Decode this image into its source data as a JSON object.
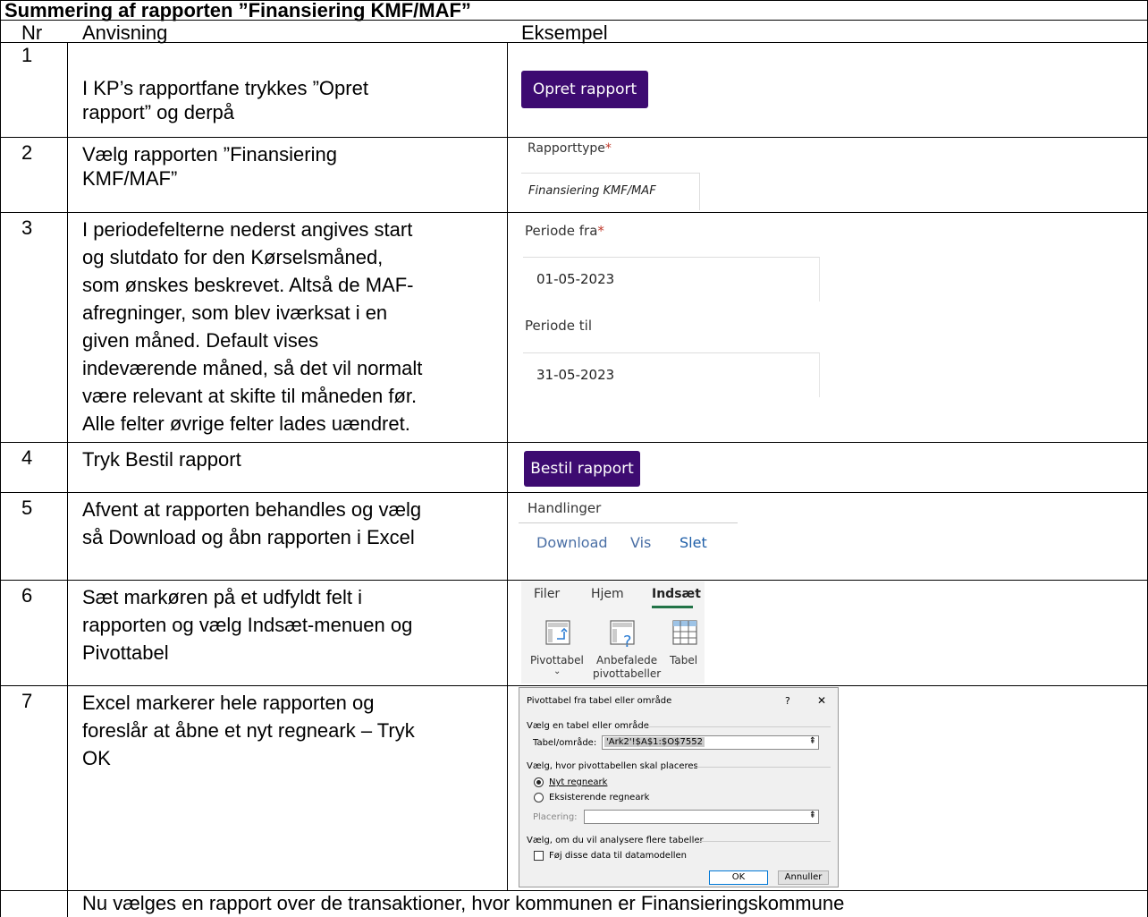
{
  "title": "Summering af rapporten ”Finansiering KMF/MAF”",
  "columns": {
    "nr": "Nr",
    "instruction": "Anvisning",
    "example": "Eksempel"
  },
  "rows": [
    {
      "nr": "1",
      "lines": [
        "I KP’s rapportfane trykkes ”Opret",
        "rapport” og derpå"
      ]
    },
    {
      "nr": "2",
      "lines": [
        "Vælg rapporten ”Finansiering",
        "KMF/MAF”"
      ]
    },
    {
      "nr": "3",
      "lines": [
        "I periodefelterne nederst angives start",
        "og slutdato for den Kørselsmåned,",
        "som ønskes beskrevet. Altså de MAF-",
        "afregninger, som blev iværksat i en",
        "given måned. Default vises",
        "indeværende måned, så det vil normalt",
        "være relevant at skifte til måneden før.",
        "Alle felter øvrige felter lades uændret."
      ]
    },
    {
      "nr": "4",
      "lines": [
        "Tryk Bestil rapport"
      ]
    },
    {
      "nr": "5",
      "lines": [
        "Afvent at rapporten behandles og vælg",
        "så Download og åbn rapporten i Excel"
      ]
    },
    {
      "nr": "6",
      "lines": [
        "Sæt markøren på et udfyldt felt i",
        "rapporten og vælg Indsæt-menuen og",
        "Pivottabel"
      ]
    },
    {
      "nr": "7",
      "lines": [
        "Excel markerer hele rapporten og",
        "foreslår at åbne et nyt regneark – Tryk",
        "OK"
      ]
    }
  ],
  "footer_text": "Nu vælges en rapport over de transaktioner, hvor kommunen er Finansieringskommune",
  "examples": {
    "opret_button": "Opret rapport",
    "rapporttype_label": "Rapporttype",
    "required_mark": "*",
    "rapporttype_value": "Finansiering KMF/MAF",
    "periode_fra_label": "Periode fra",
    "periode_fra_value": "01-05-2023",
    "periode_til_label": "Periode til",
    "periode_til_value": "31-05-2023",
    "bestil_button": "Bestil rapport",
    "handlinger_label": "Handlinger",
    "download_link": "Download",
    "vis_link": "Vis",
    "slet_link": "Slet",
    "ribbon_tabs": [
      "Filer",
      "Hjem",
      "Indsæt"
    ],
    "ribbon_pivot": "Pivottabel",
    "ribbon_pivot_arrow": "⌄",
    "ribbon_recommended_1": "Anbefalede",
    "ribbon_recommended_2": "pivottabeller",
    "ribbon_table": "Tabel",
    "accent_color": "#3d0b71",
    "link_color": "#1f5fa8"
  },
  "dialog": {
    "title": "Pivottabel fra tabel eller område",
    "help": "?",
    "close": "✕",
    "section1": "Vælg en tabel eller område",
    "table_label": "Tabel/område:",
    "table_value": "'Ark2'!$A$1:$O$7552",
    "section2": "Vælg, hvor pivottabellen skal placeres",
    "radio_new": "Nyt regneark",
    "radio_existing": "Eksisterende regneark",
    "placement_label": "Placering:",
    "section3": "Vælg, om du vil analysere flere tabeller",
    "checkbox_label": "Føj disse data til datamodellen",
    "ok": "OK",
    "cancel": "Annuller"
  }
}
